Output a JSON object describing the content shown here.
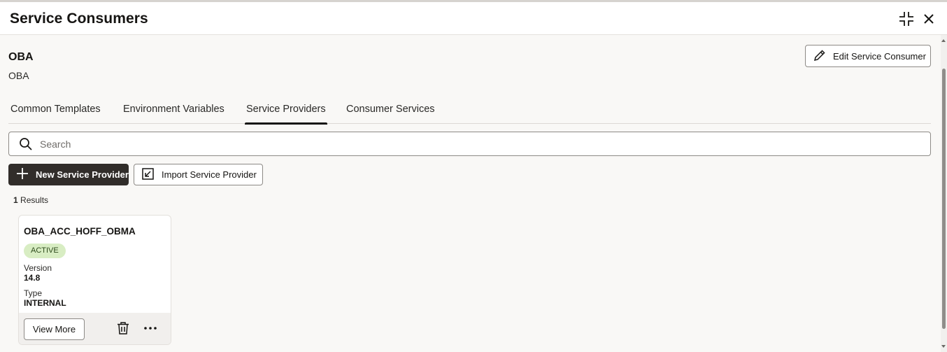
{
  "header": {
    "title": "Service Consumers",
    "icons": [
      "collapse-icon",
      "close-icon"
    ]
  },
  "consumer": {
    "name": "OBA",
    "description": "OBA",
    "edit_label": "Edit Service Consumer"
  },
  "tabs": [
    {
      "label": "Common Templates",
      "active": false
    },
    {
      "label": "Environment Variables",
      "active": false
    },
    {
      "label": "Service Providers",
      "active": true
    },
    {
      "label": "Consumer Services",
      "active": false
    }
  ],
  "search": {
    "placeholder": "Search",
    "value": ""
  },
  "actions": {
    "new_label": "New Service Provider",
    "import_label": "Import Service Provider"
  },
  "results": {
    "count": "1",
    "label": "Results"
  },
  "cards": [
    {
      "title": "OBA_ACC_HOFF_OBMA",
      "status": "ACTIVE",
      "version_label": "Version",
      "version": "14.8",
      "type_label": "Type",
      "type": "INTERNAL",
      "view_label": "View More"
    }
  ],
  "colors": {
    "primary_button": "#312d2a",
    "status_active_bg": "#d8edc3",
    "background": "#f9f8f6"
  }
}
